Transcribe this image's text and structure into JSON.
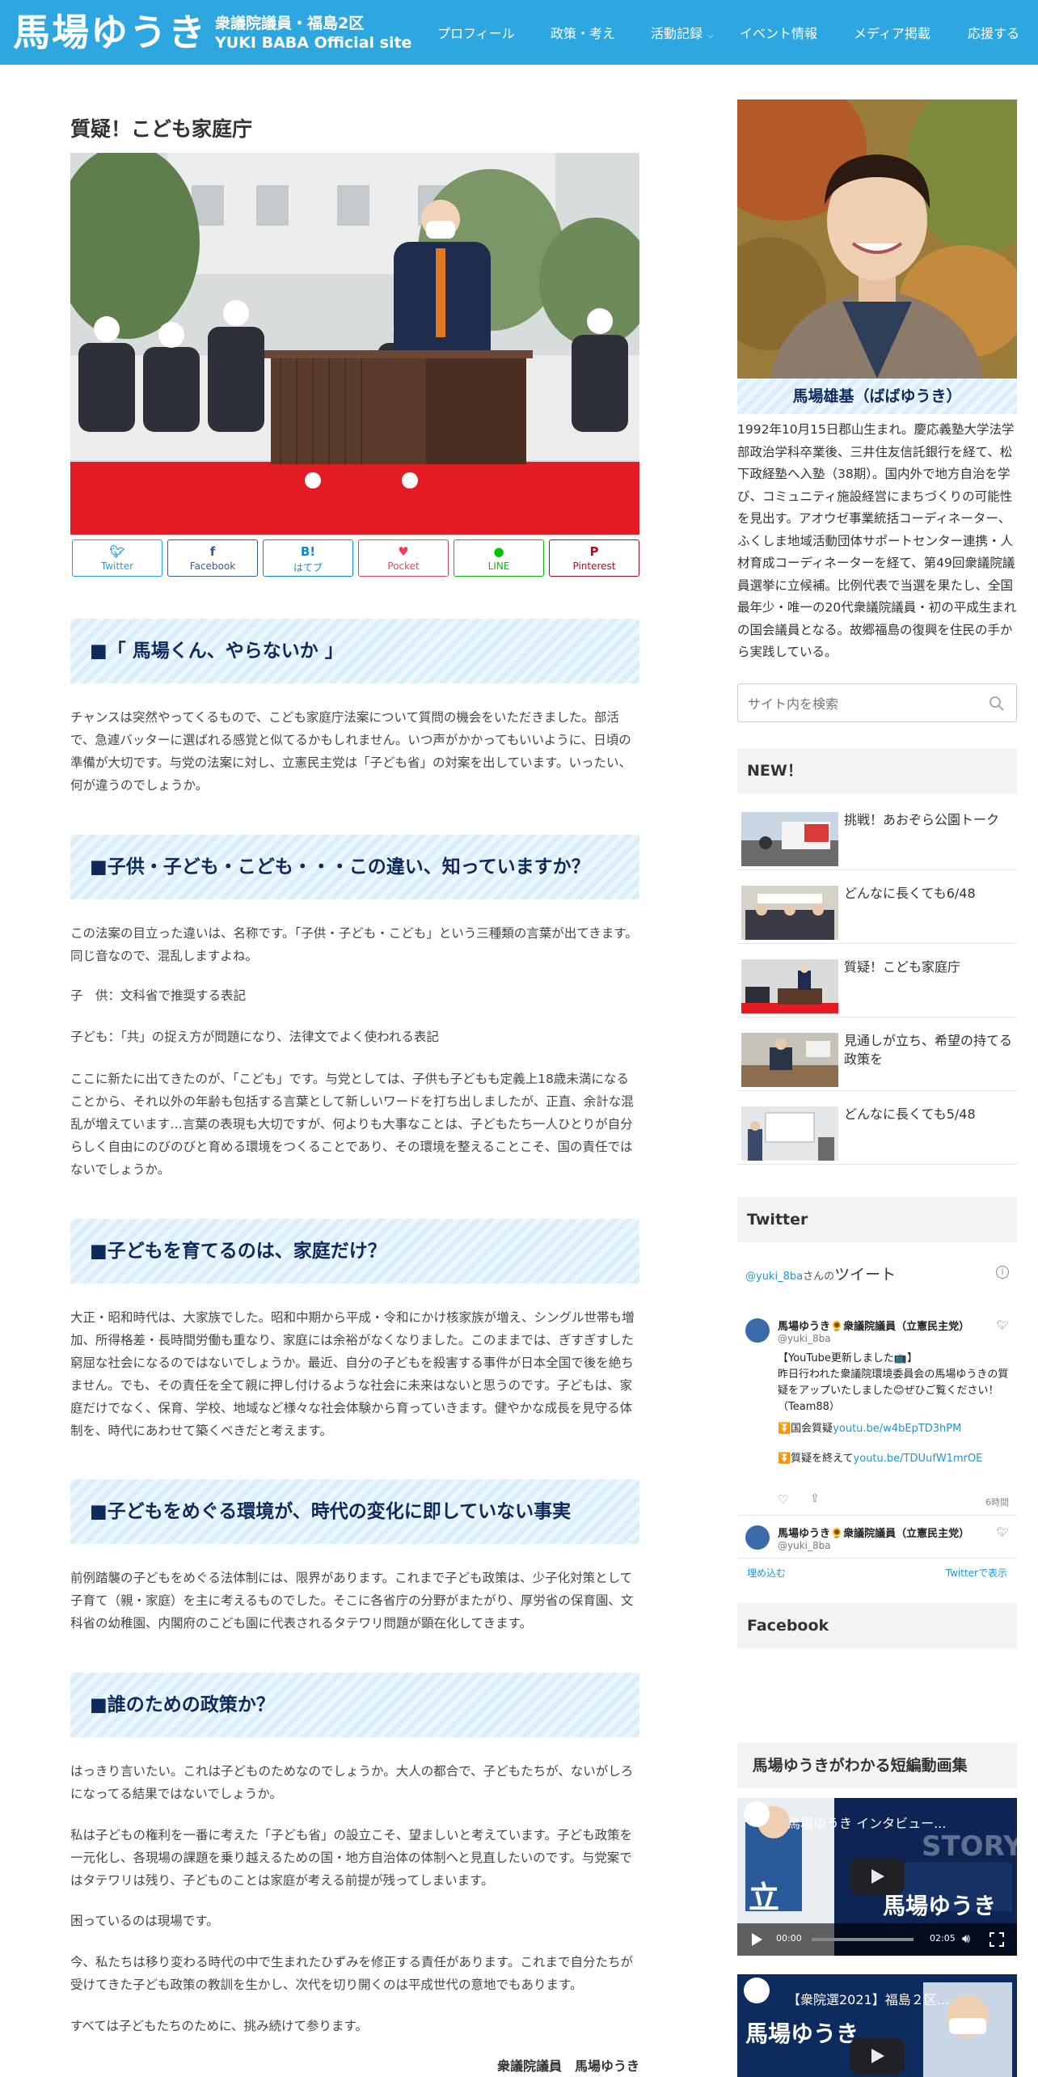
{
  "header": {
    "site_name": "馬場ゆうき",
    "subtitle1": "衆議院議員・福島2区",
    "subtitle2": "YUKI BABA Official site",
    "nav": [
      "プロフィール",
      "政策・考え",
      "活動記録",
      "イベント情報",
      "メディア掲載",
      "応援する"
    ]
  },
  "article": {
    "title": "質疑！こども家庭庁",
    "share": [
      {
        "icon": "twitter-icon",
        "label": "Twitter",
        "color": "#1da1f2"
      },
      {
        "icon": "facebook-icon",
        "label": "Facebook",
        "color": "#3b5998"
      },
      {
        "icon": "hatena-icon",
        "label": "はてブ",
        "color": "#008fde",
        "glyph": "B!"
      },
      {
        "icon": "pocket-icon",
        "label": "Pocket",
        "color": "#ef3f56"
      },
      {
        "icon": "line-icon",
        "label": "LINE",
        "color": "#00c300"
      },
      {
        "icon": "pinterest-icon",
        "label": "Pinterest",
        "color": "#bd081c"
      }
    ],
    "h_1": "■「 馬場くん、やらないか 」",
    "p_1": "チャンスは突然やってくるもので、こども家庭庁法案について質問の機会をいただきました。部活で、急遽バッターに選ばれる感覚と似てるかもしれません。いつ声がかかってもいいように、日頃の準備が大切です。与党の法案に対し、立憲民主党は「子ども省」の対案を出しています。いったい、何が違うのでしょうか。",
    "h_2": "■子供・子ども・こども・・・この違い、知っていますか？",
    "p_2": "この法案の目立った違いは、名称です。「子供・子ども・こども」という三種類の言葉が出てきます。同じ音なので、混乱しますよね。",
    "p_3": "子　供：文科省で推奨する表記",
    "p_4": "子ども：「共」の捉え方が問題になり、法律文でよく使われる表記",
    "p_5": "ここに新たに出てきたのが、「こども」です。与党としては、子供も子どもも定義上18歳未満になることから、それ以外の年齢も包括する言葉として新しいワードを打ち出しましたが、正直、余計な混乱が増えています…言葉の表現も大切ですが、何よりも大事なことは、子どもたち一人ひとりが自分らしく自由にのびのびと育める環境をつくることであり、その環境を整えることこそ、国の責任ではないでしょうか。",
    "h_3": "■子どもを育てるのは、家庭だけ？",
    "p_6": "大正・昭和時代は、大家族でした。昭和中期から平成・令和にかけ核家族が増え、シングル世帯も増加、所得格差・長時間労働も重なり、家庭には余裕がなくなりました。このままでは、ぎすぎすした窮屈な社会になるのではないでしょうか。最近、自分の子どもを殺害する事件が日本全国で後を絶ちません。でも、その責任を全て親に押し付けるような社会に未来はないと思うのです。子どもは、家庭だけでなく、保育、学校、地域など様々な社会体験から育っていきます。健やかな成長を見守る体制を、時代にあわせて築くべきだと考えます。",
    "h_4": "■子どもをめぐる環境が、時代の変化に即していない事実",
    "p_7": "前例踏襲の子どもをめぐる法体制には、限界があります。これまで子ども政策は、少子化対策として子育て（親・家庭）を主に考えるものでした。そこに各省庁の分野がまたがり、厚労省の保育園、文科省の幼稚園、内閣府のこども園に代表されるタテワリ問題が顕在化してきます。",
    "h_5": "■誰のための政策か？",
    "p_8": "はっきり言いたい。これは子どものためなのでしょうか。大人の都合で、子どもたちが、ないがしろになってる結果ではないでしょうか。",
    "p_9": "私は子どもの権利を一番に考えた「子ども省」の設立こそ、望ましいと考えています。子ども政策を一元化し、各現場の課題を乗り越えるための国・地方自治体の体制へと見直したいのです。与党案ではタテワリは残り、子どものことは家庭が考える前提が残ってしまいます。",
    "p_10": "困っているのは現場です。",
    "p_11": "今、私たちは移り変わる時代の中で生まれたひずみを修正する責任があります。これまで自分たちが受けてきた子ども政策の教訓を生かし、次代を切り開くのは平成世代の意地でもあります。",
    "p_12": "すべては子どもたちのために、挑み続けて参ります。",
    "signature": "衆議院議員　馬場ゆうき"
  },
  "sidebar": {
    "profile_name": "馬場雄基（ばばゆうき）",
    "profile_bio": "1992年10月15日郡山生まれ。慶応義塾大学法学部政治学科卒業後、三井住友信託銀行を経て、松下政経塾へ入塾（38期）。国内外で地方自治を学び、コミュニティ施設経営にまちづくりの可能性を見出す。アオウゼ事業統括コーディネーター、ふくしま地域活動団体サポートセンター連携・人材育成コーディネーターを経て、第49回衆議院議員選挙に立候補。比例代表で当選を果たし、全国最年少・唯一の20代衆議院議員・初の平成生まれの国会議員となる。故郷福島の復興を住民の手から実践している。",
    "search_placeholder": "サイト内を検索",
    "new_title": "NEW！",
    "new_items": [
      "挑戦！あおぞら公園トーク",
      "どんなに長くても6/48",
      "質疑！こども家庭庁",
      "見通しが立ち、希望の持てる政策を",
      "どんなに長くても5/48"
    ],
    "twitter_title": "Twitter",
    "twitter": {
      "handle_prefix": "@yuki_8ba",
      "handle_suffix": "さんの",
      "label": "ツイート",
      "name": "馬場ゆうき🌻衆議院議員（立憲民主党）",
      "handle": "@yuki_8ba",
      "line1": "【YouTube更新しました📺】",
      "line2": "昨日行われた衆議院環境委員会の馬場ゆうきの質疑をアップいたしました😊ぜひご覧ください！（Team88）",
      "line3a": "⏬国会質疑",
      "line3b": "youtu.be/w4bEpTD3hPM",
      "line4a": "⏬質疑を終えて",
      "line4b": "youtu.be/TDUufW1mrOE",
      "time": "6時間",
      "embed": "埋め込む",
      "view": "Twitterで表示"
    },
    "facebook_title": "Facebook",
    "video_title": "馬場ゆうきがわかる短編動画集",
    "video1": {
      "title": "馬場ゆうき インタビュー...",
      "time_now": "00:00",
      "time_total": "02:05",
      "overlay1": "STORY",
      "overlay2": "馬場ゆうき",
      "overlay3": "立"
    },
    "video2": {
      "title": "【衆院選2021】福島２区...",
      "overlay": "馬場ゆうき"
    }
  },
  "colors": {
    "header_bg": "#2ea7e0",
    "heading_text": "#0d2a5b",
    "link": "#1b95e0"
  }
}
